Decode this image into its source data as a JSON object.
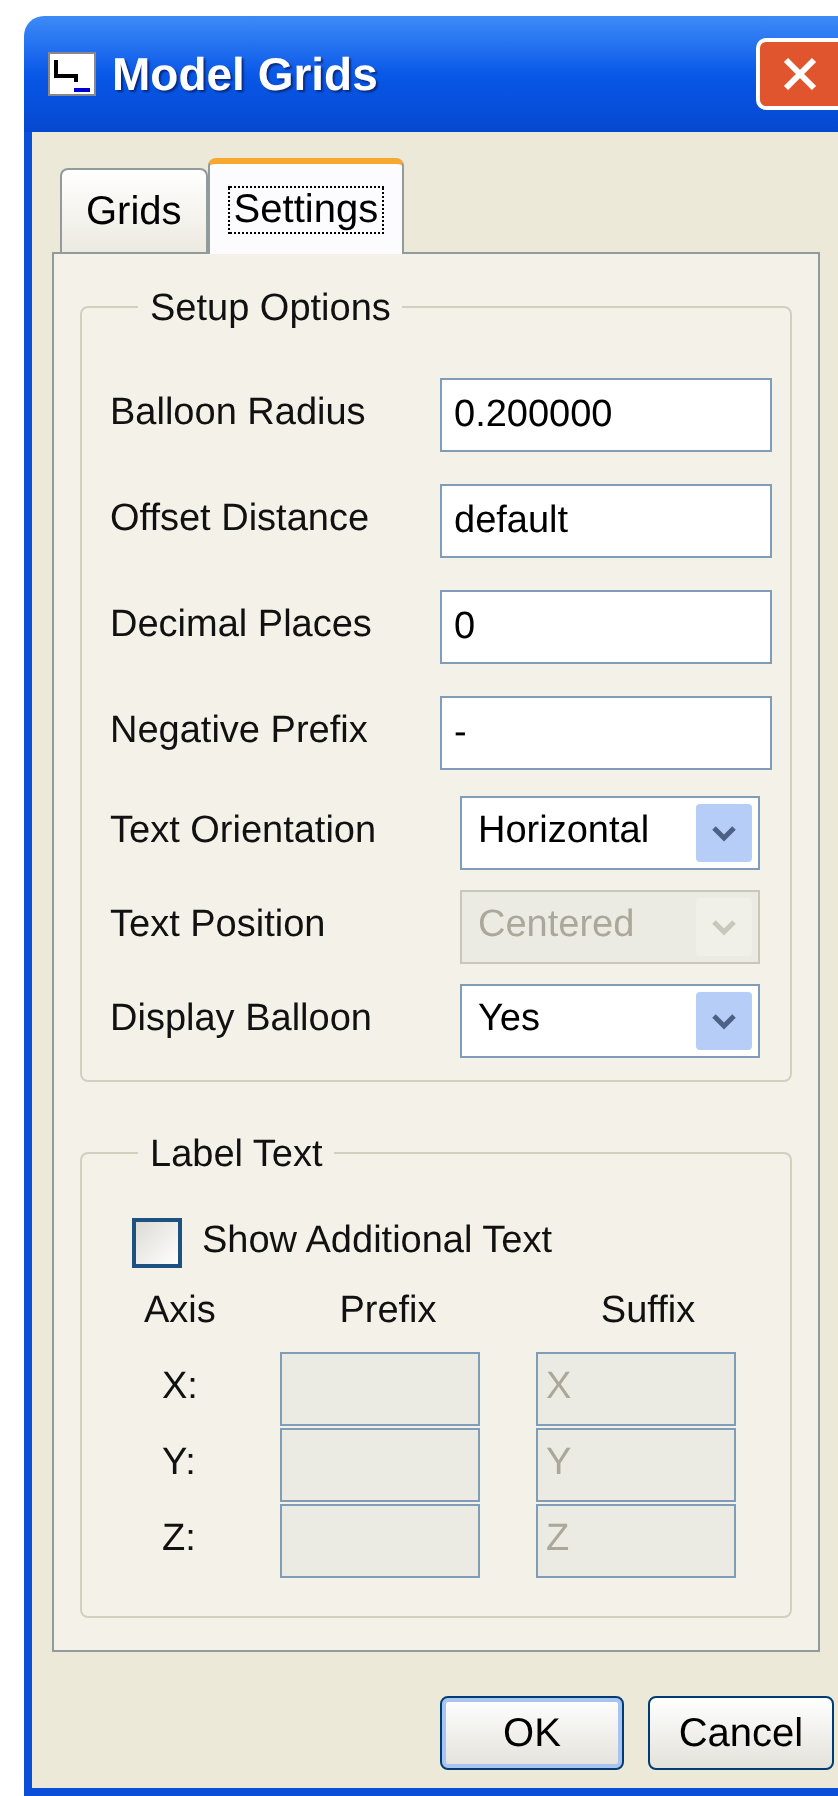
{
  "window": {
    "title": "Model Grids"
  },
  "tabs": [
    {
      "label": "Grids",
      "selected": false
    },
    {
      "label": "Settings",
      "selected": true
    }
  ],
  "setup_options": {
    "title": "Setup Options",
    "fields": [
      {
        "kind": "text",
        "label": "Balloon Radius",
        "value": "0.200000",
        "disabled": false
      },
      {
        "kind": "text",
        "label": "Offset Distance",
        "value": "default",
        "disabled": false
      },
      {
        "kind": "text",
        "label": "Decimal Places",
        "value": "0",
        "disabled": false
      },
      {
        "kind": "text",
        "label": "Negative Prefix",
        "value": "-",
        "disabled": false
      },
      {
        "kind": "dropdown",
        "label": "Text Orientation",
        "value": "Horizontal",
        "disabled": false
      },
      {
        "kind": "dropdown",
        "label": "Text Position",
        "value": "Centered",
        "disabled": true
      },
      {
        "kind": "dropdown",
        "label": "Display Balloon",
        "value": "Yes",
        "disabled": false
      }
    ]
  },
  "label_text": {
    "title": "Label Text",
    "checkbox": {
      "label": "Show Additional Text",
      "checked": false
    },
    "columns": [
      "Axis",
      "Prefix",
      "Suffix"
    ],
    "rows": [
      {
        "axis": "X:",
        "suffix": "X",
        "disabled": true
      },
      {
        "axis": "Y:",
        "suffix": "Y",
        "disabled": true
      },
      {
        "axis": "Z:",
        "suffix": "Z",
        "disabled": true
      }
    ]
  },
  "buttons": [
    {
      "label": "OK",
      "default": true
    },
    {
      "label": "Cancel",
      "default": false
    }
  ]
}
